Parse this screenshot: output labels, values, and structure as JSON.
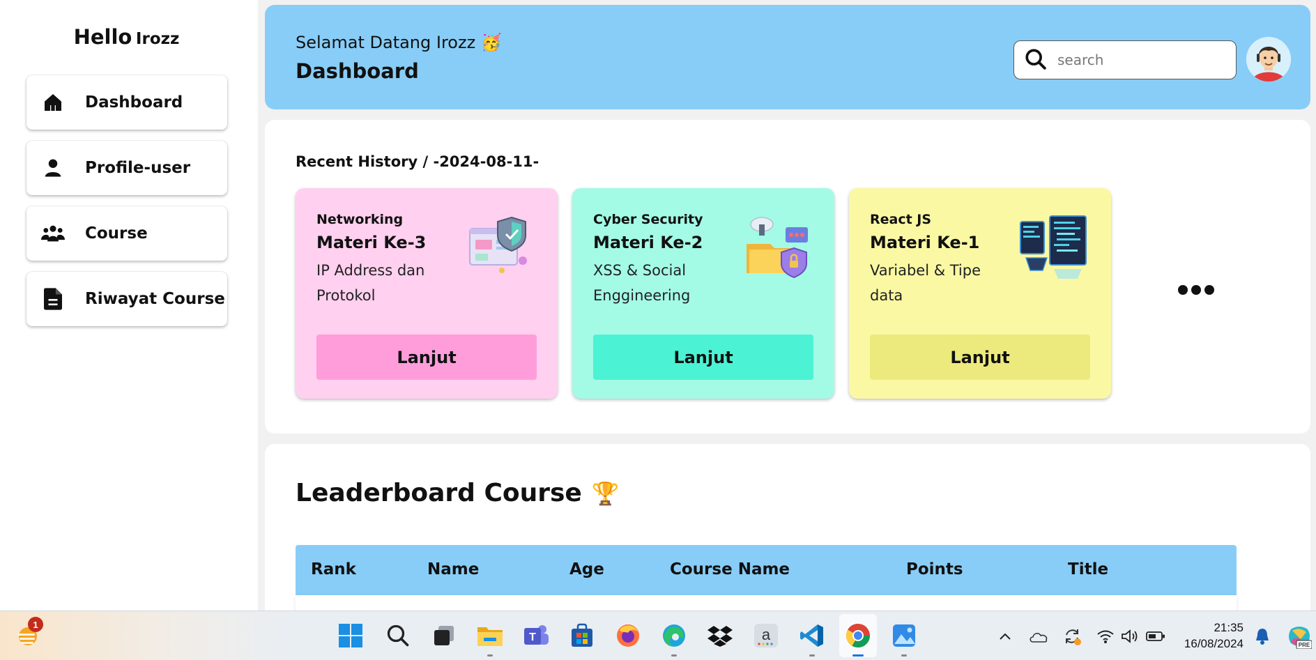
{
  "sidebar": {
    "greeting": "Hello",
    "username": "Irozz",
    "items": [
      {
        "label": "Dashboard",
        "icon": "home-icon"
      },
      {
        "label": "Profile-user",
        "icon": "user-icon"
      },
      {
        "label": "Course",
        "icon": "group-icon"
      },
      {
        "label": "Riwayat Course",
        "icon": "document-icon"
      }
    ]
  },
  "header": {
    "welcome": "Selamat Datang Irozz 🥳",
    "title": "Dashboard",
    "search_placeholder": "search",
    "avatar_icon": "avatar-icon"
  },
  "recent": {
    "title": "Recent History / -2024-08-11-",
    "cards": [
      {
        "category": "Networking",
        "materi": "Materi Ke-3",
        "desc": "IP Address dan Protokol",
        "button": "Lanjut",
        "bg": "#ffd0ef",
        "btn_bg": "#ff9ddb"
      },
      {
        "category": "Cyber Security",
        "materi": "Materi Ke-2",
        "desc": "XSS & Social Enggineering",
        "button": "Lanjut",
        "bg": "#a3fbe6",
        "btn_bg": "#4cf2d4"
      },
      {
        "category": "React JS",
        "materi": "Materi Ke-1",
        "desc": "Variabel & Tipe data",
        "button": "Lanjut",
        "bg": "#fbf8a3",
        "btn_bg": "#ecea7d"
      }
    ],
    "more_icon": "more-icon"
  },
  "leaderboard": {
    "title": "Leaderboard Course",
    "trophy": "🏆",
    "columns": [
      "Rank",
      "Name",
      "Age",
      "Course Name",
      "Points",
      "Title"
    ]
  },
  "taskbar": {
    "notification_count": "1",
    "time": "21:35",
    "date": "16/08/2024",
    "apps": [
      "windows-start-icon",
      "search-icon",
      "task-view-icon",
      "file-explorer-icon",
      "teams-icon",
      "store-icon",
      "firefox-icon",
      "edge-icon",
      "dropbox-icon",
      "amazon-icon",
      "vscode-icon",
      "chrome-icon",
      "photos-icon"
    ],
    "tray": [
      "chevron-up-icon",
      "onedrive-icon",
      "sync-icon",
      "wifi-icon",
      "volume-icon",
      "battery-icon"
    ]
  },
  "colors": {
    "header_bg": "#88cdf7",
    "table_header_bg": "#88cdf7",
    "page_bg": "#f1f1f1"
  }
}
